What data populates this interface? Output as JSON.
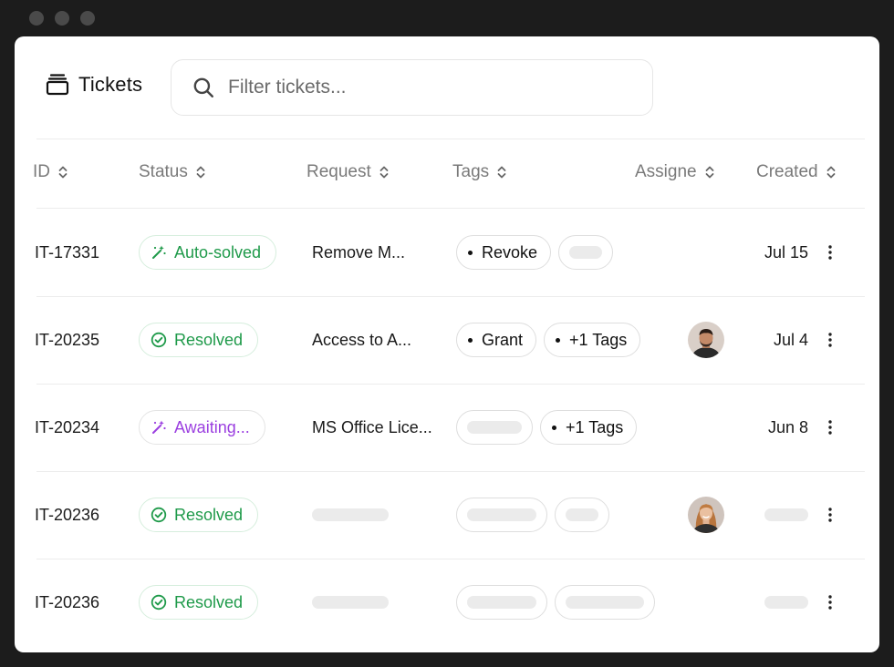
{
  "window": {
    "title": "Tickets"
  },
  "search": {
    "placeholder": "Filter tickets..."
  },
  "columns": {
    "id": "ID",
    "status": "Status",
    "request": "Request",
    "tags": "Tags",
    "assignee": "Assigne",
    "created": "Created"
  },
  "rows": [
    {
      "id": "IT-17331",
      "status": "Auto-solved",
      "request": "Remove M...",
      "tags": [
        "Revoke"
      ],
      "created": "Jul 15"
    },
    {
      "id": "IT-20235",
      "status": "Resolved",
      "request": "Access to A...",
      "tags": [
        "Grant",
        "+1 Tags"
      ],
      "created": "Jul 4"
    },
    {
      "id": "IT-20234",
      "status": "Awaiting...",
      "request": "MS Office Lice...",
      "tags": [
        "+1 Tags"
      ],
      "created": "Jun 8"
    },
    {
      "id": "IT-20236",
      "status": "Resolved"
    },
    {
      "id": "IT-20236",
      "status": "Resolved"
    }
  ],
  "colors": {
    "resolved": "#1f9a4a",
    "awaiting": "#9b3fe0",
    "frame": "#1c1c1c",
    "skeleton": "#ebebeb"
  }
}
